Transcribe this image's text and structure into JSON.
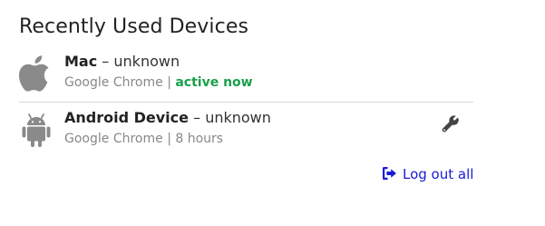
{
  "section": {
    "title": "Recently Used Devices"
  },
  "devices": [
    {
      "icon": "apple-icon",
      "name": "Mac",
      "separator": "–",
      "status": "unknown",
      "browser": "Google Chrome",
      "meta_separator": "|",
      "last_active": "active now",
      "last_active_color": "#1a9e4a"
    },
    {
      "icon": "android-icon",
      "name": "Android Device",
      "separator": "–",
      "status": "unknown",
      "browser": "Google Chrome",
      "meta_separator": "|",
      "last_active": "8 hours",
      "action_icon": "wrench-icon"
    }
  ],
  "actions": {
    "logout_all_label": "Log out all",
    "logout_icon": "sign-out-icon",
    "link_color": "#1a1ad6"
  }
}
